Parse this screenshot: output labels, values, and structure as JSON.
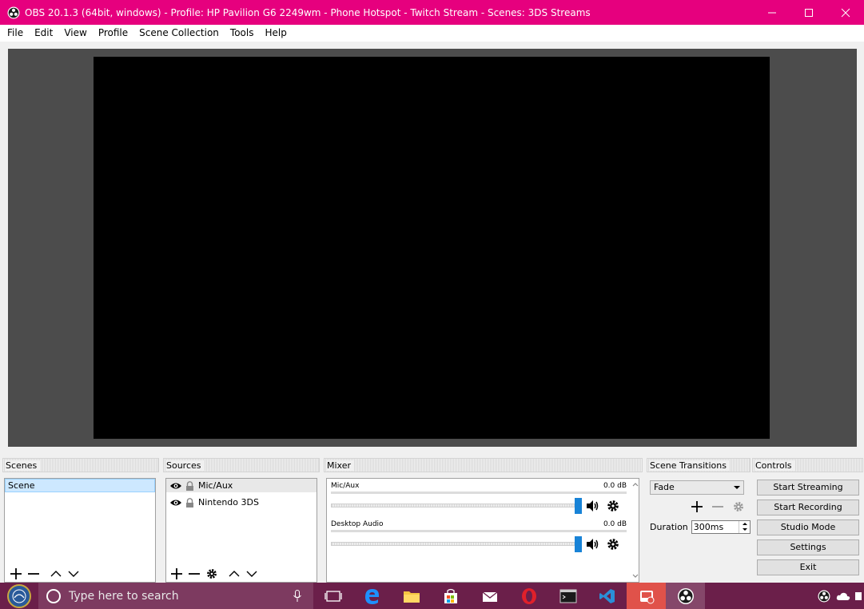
{
  "window": {
    "title": "OBS 20.1.3 (64bit, windows) - Profile: HP Pavilion G6 2249wm - Phone Hotspot - Twitch Stream - Scenes: 3DS Streams",
    "accent_color": "#e6007e"
  },
  "menu": [
    "File",
    "Edit",
    "View",
    "Profile",
    "Scene Collection",
    "Tools",
    "Help"
  ],
  "scenes": {
    "title": "Scenes",
    "items": [
      "Scene"
    ]
  },
  "sources": {
    "title": "Sources",
    "items": [
      "Mic/Aux",
      "Nintendo 3DS"
    ]
  },
  "mixer": {
    "title": "Mixer",
    "channels": [
      {
        "name": "Mic/Aux",
        "level": "0.0 dB"
      },
      {
        "name": "Desktop Audio",
        "level": "0.0 dB"
      }
    ]
  },
  "transitions": {
    "title": "Scene Transitions",
    "selected": "Fade",
    "duration_label": "Duration",
    "duration_value": "300ms"
  },
  "controls": {
    "title": "Controls",
    "buttons": [
      "Start Streaming",
      "Start Recording",
      "Studio Mode",
      "Settings",
      "Exit"
    ]
  },
  "taskbar": {
    "search_placeholder": "Type here to search",
    "color": "#6b1f4a"
  }
}
